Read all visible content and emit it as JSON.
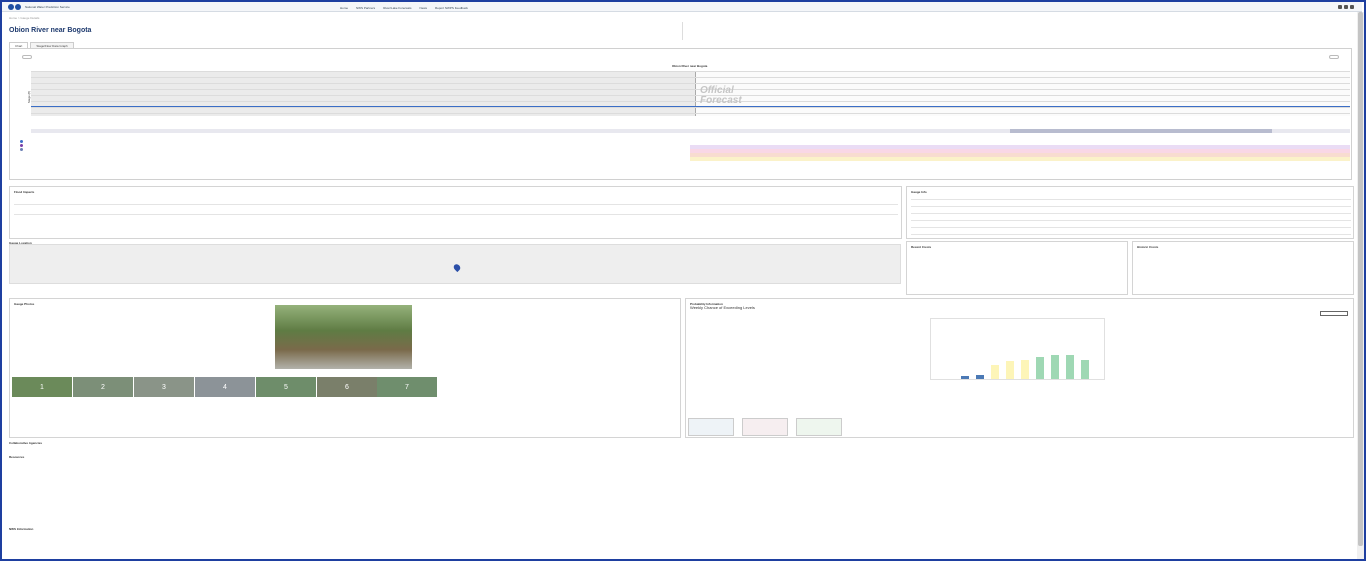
{
  "header": {
    "agency": "National Water Prediction Service",
    "nav": [
      "Home",
      "NWS Partners",
      "River/Lake Forecasts",
      "News",
      "Report NWPS Feedback"
    ]
  },
  "breadcrumb": "Home > Gauge Details",
  "gauge": {
    "title": "Obion River near Bogota",
    "subtitle": "",
    "right_note": ""
  },
  "tabs": [
    "Chart",
    "Stage/Flow Data Graph"
  ],
  "hydrograph": {
    "left_button": "",
    "right_button": "",
    "red_message": "",
    "chart_title": "Obion River near Bogota",
    "chart_subtitle": "",
    "watermark_line1": "Official",
    "watermark_line2": "Forecast",
    "observed_label": "",
    "forecast_label": "",
    "yaxis": "Stage (ft)",
    "legend_title": "",
    "legend_items": [],
    "note1": "",
    "note2": ""
  },
  "flood_impacts": {
    "title": "Flood Impacts",
    "lines": []
  },
  "gauge_info": {
    "title": "Gauge Info"
  },
  "gauge_location": {
    "title": "Gauge Location"
  },
  "recent_crests": {
    "title": "Recent Crests"
  },
  "historic_crests": {
    "title": "Historic Crests"
  },
  "gauge_photos": {
    "title": "Gauge Photos",
    "thumbs": [
      "1",
      "2",
      "3",
      "4",
      "5",
      "6",
      "7"
    ]
  },
  "probability": {
    "title": "Probability Information",
    "chart_title": "Weekly Chance of Exceeding Levels"
  },
  "collab": {
    "title": "Collaborative Agencies"
  },
  "resources": {
    "title": "Resources"
  },
  "footer": {
    "title": "NWS Information"
  },
  "colors": {
    "accent": "#1e3a6e",
    "observed": "#3b6ec6"
  }
}
